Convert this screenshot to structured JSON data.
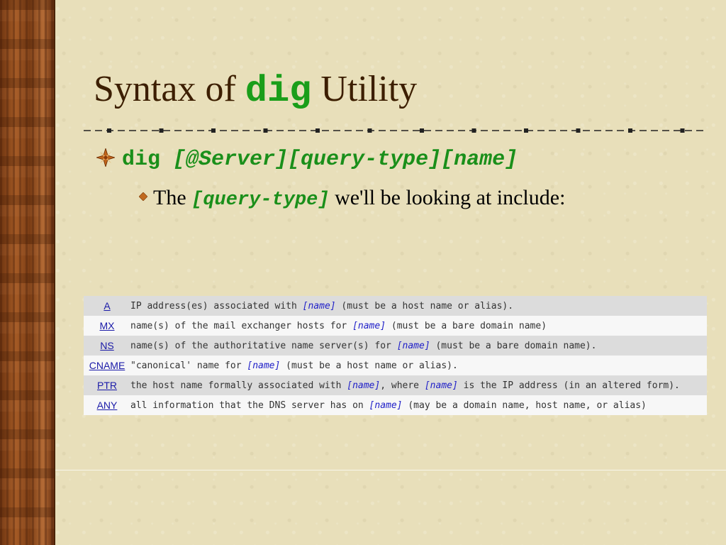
{
  "title": {
    "prefix": "Syntax of ",
    "code": "dig",
    "suffix": " Utility"
  },
  "bullet1": {
    "cmd": "dig",
    "args": " [@Server][query-type][name]"
  },
  "bullet2": {
    "prefix": "The ",
    "code": "[query-type]",
    "suffix": " we'll be looking at include:"
  },
  "table": {
    "rows": [
      {
        "type": "A",
        "parts": [
          "IP address(es) associated with ",
          "[name]",
          " (must be a host name or alias)."
        ]
      },
      {
        "type": "MX",
        "parts": [
          "name(s) of the mail exchanger hosts for ",
          "[name]",
          " (must be a bare domain name)"
        ]
      },
      {
        "type": "NS",
        "parts": [
          "name(s) of the authoritative name server(s) for ",
          "[name]",
          " (must be a bare domain name)."
        ]
      },
      {
        "type": "CNAME",
        "parts": [
          "\"canonical' name for ",
          "[name]",
          " (must be a host name or alias)."
        ]
      },
      {
        "type": "PTR",
        "parts": [
          "the host name formally associated with ",
          "[name]",
          ", where ",
          "[name]",
          " is the IP address (in an altered form)."
        ]
      },
      {
        "type": "ANY",
        "parts": [
          "all information that the DNS server has on ",
          "[name]",
          " (may be a domain name, host name, or alias)"
        ]
      }
    ]
  },
  "icons": {
    "bullet1": "compass-star-icon",
    "bullet2": "diamond-bullet-icon"
  },
  "colors": {
    "title": "#3c1e00",
    "code": "#1a9e1a",
    "link": "#1a1aa8",
    "name_ref": "#2020c8"
  }
}
